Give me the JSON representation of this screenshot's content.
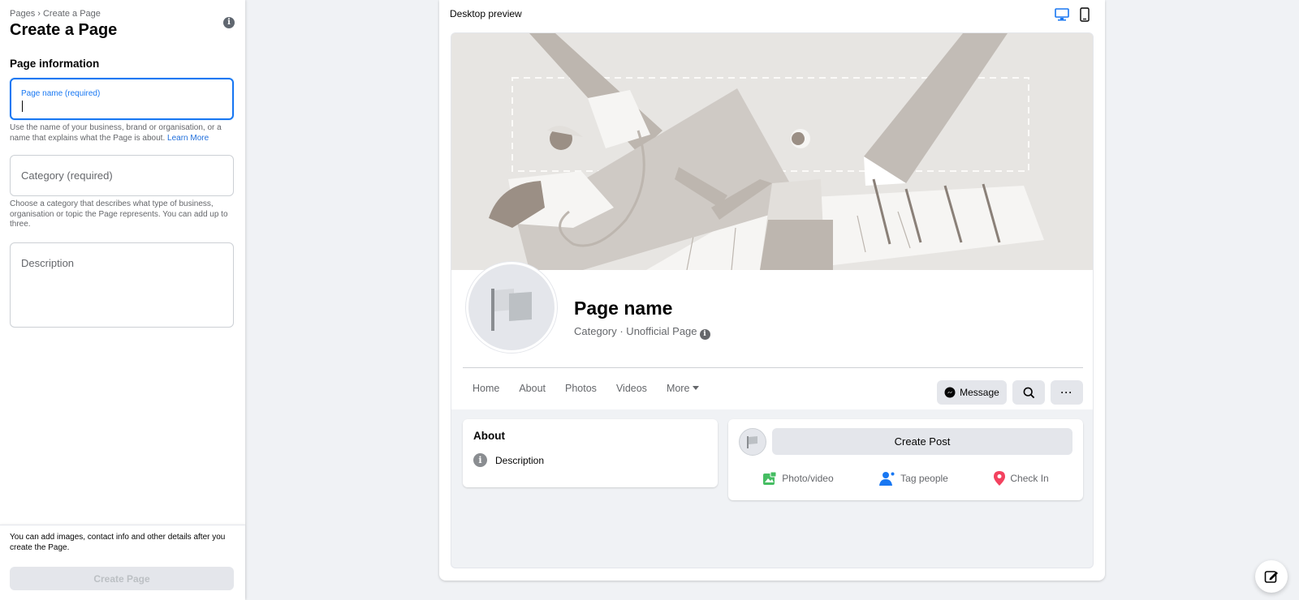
{
  "sidebar": {
    "breadcrumb": "Pages › Create a Page",
    "title": "Create a Page",
    "section_title": "Page information",
    "page_name_label": "Page name (required)",
    "page_name_value": "",
    "page_name_help": "Use the name of your business, brand or organisation, or a name that explains what the Page is about.",
    "learn_more": "Learn More",
    "category_placeholder": "Category (required)",
    "category_help": "Choose a category that describes what type of business, organisation or topic the Page represents. You can add up to three.",
    "description_placeholder": "Description",
    "footer_note": "You can add images, contact info and other details after you create the Page.",
    "create_button": "Create Page"
  },
  "preview": {
    "label": "Desktop preview",
    "devices": [
      "desktop-icon",
      "mobile-icon"
    ],
    "page_name": "Page name",
    "category_line": "Category · Unofficial Page",
    "tabs": [
      "Home",
      "About",
      "Photos",
      "Videos",
      "More"
    ],
    "message_button": "Message",
    "about": {
      "title": "About",
      "description": "Description"
    },
    "create_post": "Create Post",
    "post_actions": [
      "Photo/video",
      "Tag people",
      "Check In"
    ]
  },
  "colors": {
    "accent": "#1877f2",
    "background": "#f0f2f5",
    "button_grey": "#e4e6eb",
    "photo_green": "#45bd62",
    "tag_blue": "#1877f2",
    "checkin_red": "#f3425f"
  }
}
